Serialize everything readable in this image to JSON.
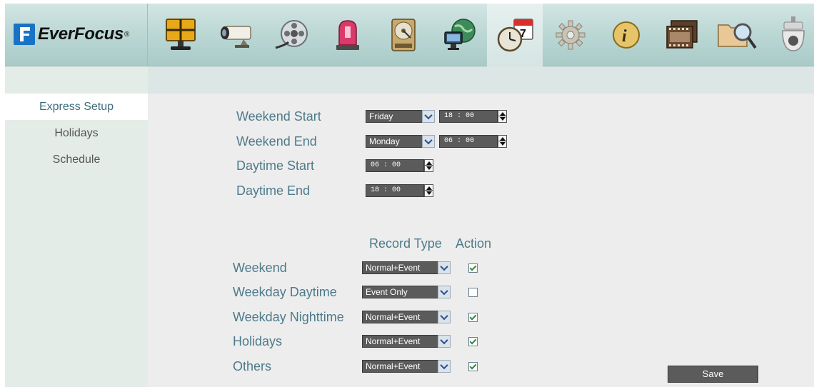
{
  "brand": {
    "name": "EverFocus",
    "reg": "®",
    "color": "#1a72c6"
  },
  "toolbar": {
    "items": [
      {
        "icon": "monitor-layout-icon"
      },
      {
        "icon": "camera-icon"
      },
      {
        "icon": "film-reel-icon"
      },
      {
        "icon": "alarm-light-icon"
      },
      {
        "icon": "hard-disk-icon"
      },
      {
        "icon": "network-globe-icon"
      },
      {
        "icon": "schedule-clock-calendar-icon",
        "active": true
      },
      {
        "icon": "gear-icon"
      },
      {
        "icon": "info-icon"
      },
      {
        "icon": "film-strip-icon"
      },
      {
        "icon": "search-folder-icon"
      },
      {
        "icon": "dome-camera-icon"
      }
    ]
  },
  "sidebar": {
    "items": [
      {
        "label": "Express Setup",
        "active": true
      },
      {
        "label": "Holidays"
      },
      {
        "label": "Schedule"
      }
    ]
  },
  "form": {
    "weekend_start": {
      "label": "Weekend Start",
      "day": "Friday",
      "time": "18 : 00"
    },
    "weekend_end": {
      "label": "Weekend End",
      "day": "Monday",
      "time": "06 : 00"
    },
    "daytime_start": {
      "label": "Daytime Start",
      "time": "06 : 00"
    },
    "daytime_end": {
      "label": "Daytime End",
      "time": "18 : 00"
    }
  },
  "table": {
    "col_record_type": "Record Type",
    "col_action": "Action",
    "rows": [
      {
        "label": "Weekend",
        "record_type": "Normal+Event",
        "action": true
      },
      {
        "label": "Weekday Daytime",
        "record_type": "Event Only",
        "action": false
      },
      {
        "label": "Weekday Nighttime",
        "record_type": "Normal+Event",
        "action": true
      },
      {
        "label": "Holidays",
        "record_type": "Normal+Event",
        "action": true
      },
      {
        "label": "Others",
        "record_type": "Normal+Event",
        "action": true
      }
    ]
  },
  "save_label": "Save"
}
